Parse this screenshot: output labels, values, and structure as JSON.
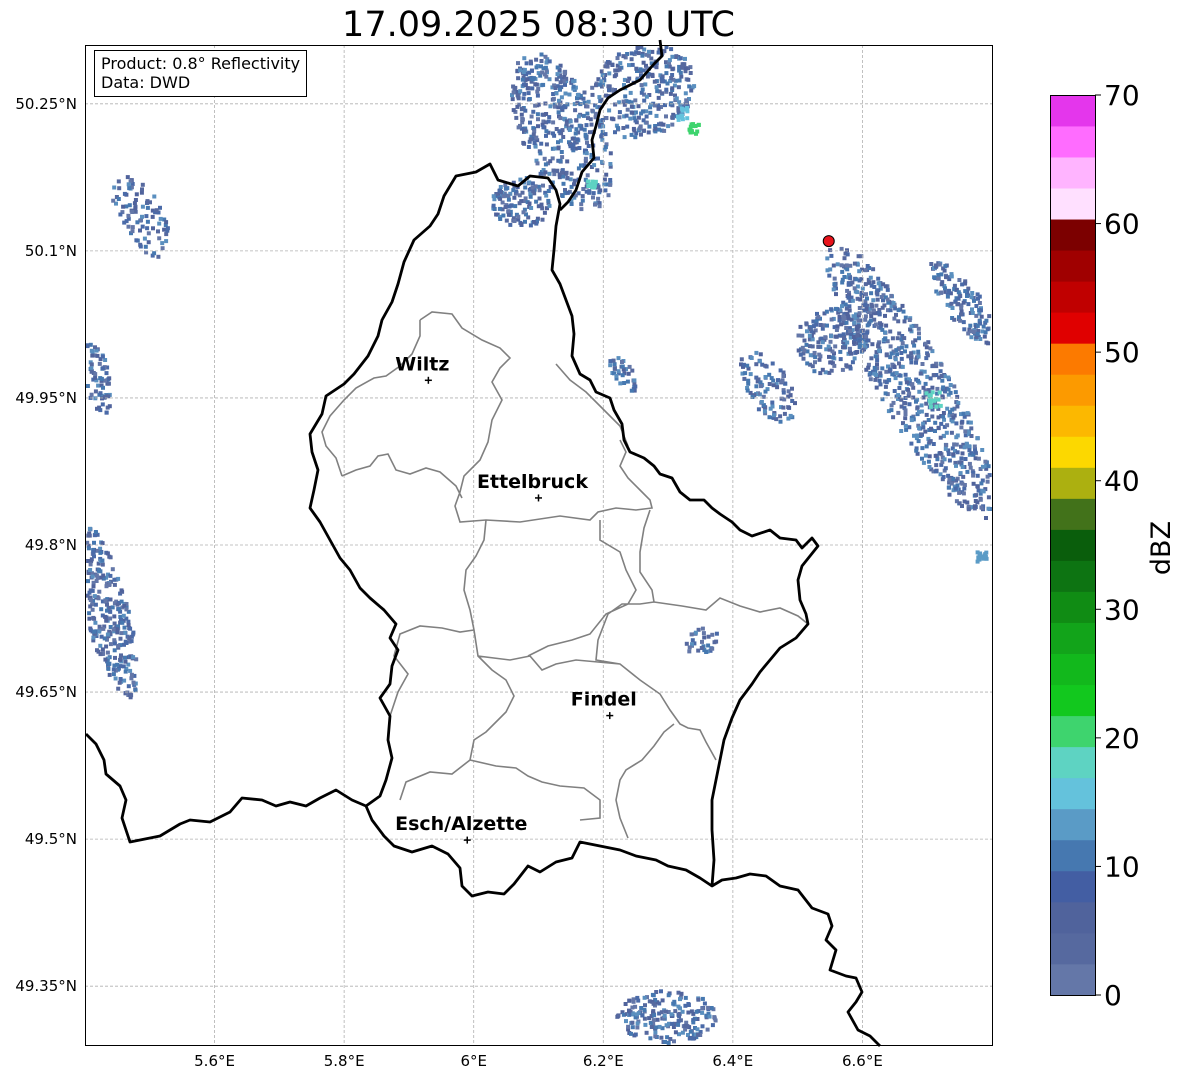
{
  "title": "17.09.2025 08:30 UTC",
  "info_box": {
    "product": "Product: 0.8° Reflectivity",
    "source": "Data: DWD"
  },
  "map": {
    "lon_range": [
      5.4,
      6.8
    ],
    "lat_range": [
      49.29,
      50.31
    ],
    "lon_ticks": [
      {
        "value": 5.6,
        "label": "5.6°E"
      },
      {
        "value": 5.8,
        "label": "5.8°E"
      },
      {
        "value": 6.0,
        "label": "6°E"
      },
      {
        "value": 6.2,
        "label": "6.2°E"
      },
      {
        "value": 6.4,
        "label": "6.4°E"
      },
      {
        "value": 6.6,
        "label": "6.6°E"
      }
    ],
    "lat_ticks": [
      {
        "value": 50.25,
        "label": "50.25°N"
      },
      {
        "value": 50.1,
        "label": "50.1°N"
      },
      {
        "value": 49.95,
        "label": "49.95°N"
      },
      {
        "value": 49.8,
        "label": "49.8°N"
      },
      {
        "value": 49.65,
        "label": "49.65°N"
      },
      {
        "value": 49.5,
        "label": "49.5°N"
      },
      {
        "value": 49.35,
        "label": "49.35°N"
      }
    ],
    "cities": [
      {
        "name": "Wiltz",
        "lon": 5.93,
        "lat": 49.968
      },
      {
        "name": "Ettelbruck",
        "lon": 6.1,
        "lat": 49.848
      },
      {
        "name": "Findel",
        "lon": 6.21,
        "lat": 49.626
      },
      {
        "name": "Esch/Alzette",
        "lon": 5.99,
        "lat": 49.499
      }
    ],
    "radar_site": {
      "lon": 6.548,
      "lat": 50.11,
      "color": "#e8141c"
    }
  },
  "colorbar": {
    "label": "dBZ",
    "min": 0,
    "max": 70,
    "tick_values": [
      0,
      10,
      20,
      30,
      40,
      50,
      60,
      70
    ],
    "colors": [
      "#6477a8",
      "#56699f",
      "#50639c",
      "#435ea3",
      "#4678b0",
      "#5a9bc6",
      "#64c2dc",
      "#5ed3c2",
      "#3ed46e",
      "#12c81e",
      "#12b81c",
      "#12a41a",
      "#108c14",
      "#0d7412",
      "#0a5e0c",
      "#42721a",
      "#acb010",
      "#fcd800",
      "#fcb800",
      "#fc9a00",
      "#fc7a00",
      "#e00000",
      "#c00000",
      "#a00000",
      "#7c0000",
      "#ffe0ff",
      "#ffb4ff",
      "#ff6cff",
      "#e436ec"
    ]
  }
}
